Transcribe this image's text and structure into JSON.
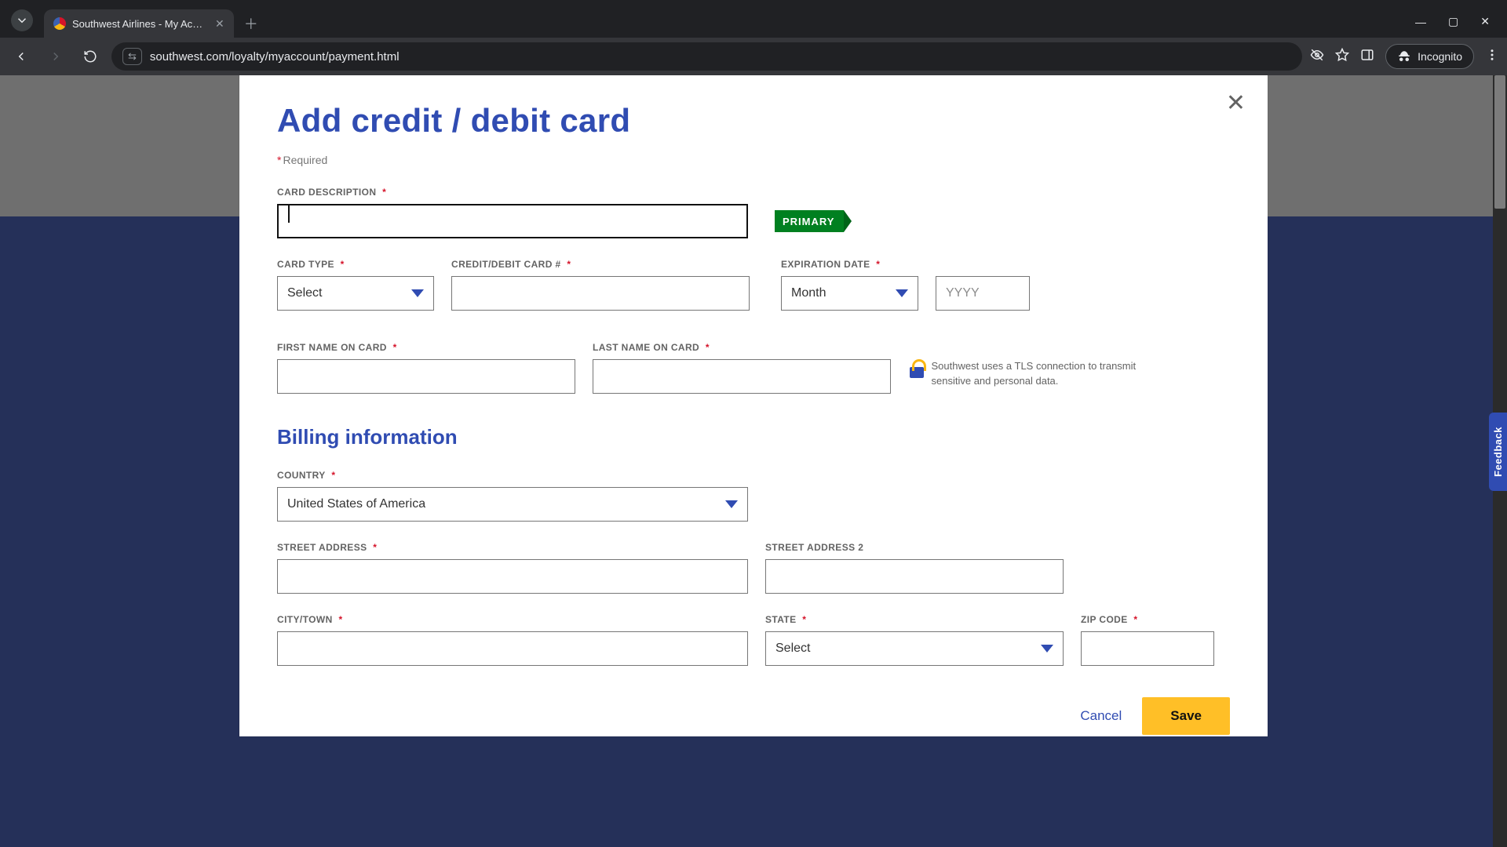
{
  "browser": {
    "tab_title": "Southwest Airlines - My Accou",
    "url": "southwest.com/loyalty/myaccount/payment.html",
    "incognito_label": "Incognito"
  },
  "feedback": {
    "label": "Feedback"
  },
  "modal": {
    "title": "Add credit / debit card",
    "required_note": "Required",
    "primary_badge": "PRIMARY",
    "labels": {
      "card_description": "CARD DESCRIPTION",
      "card_type": "CARD TYPE",
      "card_number": "CREDIT/DEBIT CARD #",
      "expiration": "EXPIRATION DATE",
      "first_name": "FIRST NAME ON CARD",
      "last_name": "LAST NAME ON CARD",
      "country": "COUNTRY",
      "street1": "STREET ADDRESS",
      "street2": "STREET ADDRESS 2",
      "city": "CITY/TOWN",
      "state": "STATE",
      "zip": "ZIP CODE"
    },
    "values": {
      "card_description": "",
      "card_type": "Select",
      "card_number": "",
      "exp_month": "Month",
      "exp_year_placeholder": "YYYY",
      "first_name": "",
      "last_name": "",
      "country": "United States of America",
      "street1": "",
      "street2": "",
      "city": "",
      "state": "Select",
      "zip": ""
    },
    "tls_note": "Southwest uses a TLS connection to transmit sensitive and personal data.",
    "billing_heading": "Billing information",
    "actions": {
      "cancel": "Cancel",
      "save": "Save"
    }
  }
}
